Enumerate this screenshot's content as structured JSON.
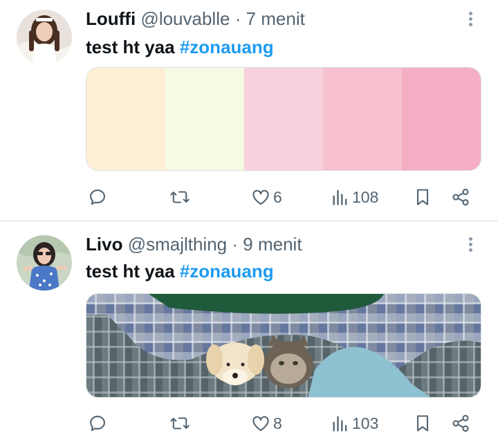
{
  "tweets": [
    {
      "name": "Louffi",
      "handle": "@louvablle",
      "separator": "·",
      "time": "7 menit",
      "text": "test ht yaa",
      "hashtag": "#zonauang",
      "media_type": "color-palette",
      "palette": [
        "#fdf0d5",
        "#f6fbe4",
        "#f9d1dc",
        "#f8c1cf",
        "#f6aec4"
      ],
      "likes": "6",
      "views": "108"
    },
    {
      "name": "Livo",
      "handle": "@smajlthing",
      "separator": "·",
      "time": "9 menit",
      "text": "test ht yaa",
      "hashtag": "#zonauang",
      "media_type": "photo-cat-under-blanket",
      "likes": "8",
      "views": "103"
    }
  ],
  "icons": {
    "reply": "reply-icon",
    "retweet": "retweet-icon",
    "like": "heart-icon",
    "views": "views-icon",
    "bookmark": "bookmark-icon",
    "share": "share-icon",
    "more": "more-vertical-icon"
  },
  "colors": {
    "text": "#0f1419",
    "secondary": "#536471",
    "hashtag": "#1d9bf0",
    "divider": "#d8dde1"
  }
}
